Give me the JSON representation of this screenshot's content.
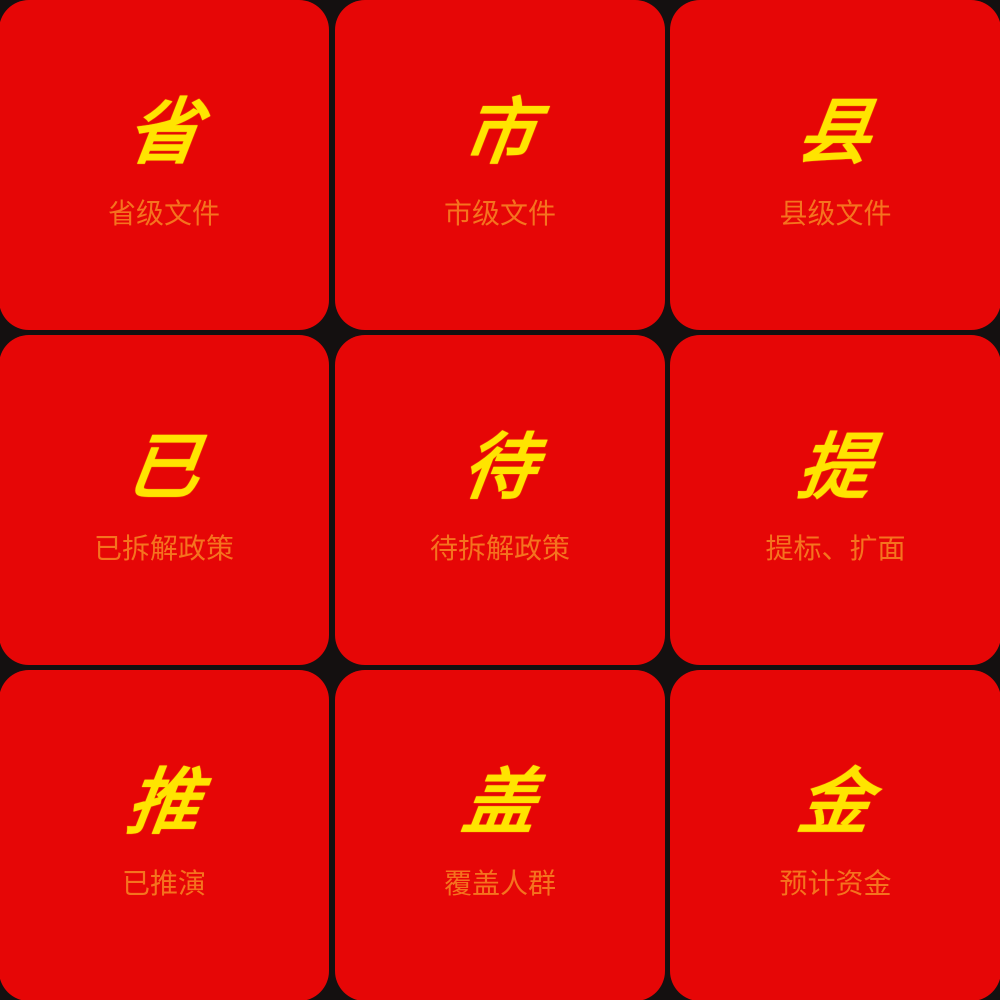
{
  "tiles": [
    {
      "id": "province",
      "big": "省",
      "label": "省级文件"
    },
    {
      "id": "city",
      "big": "市",
      "label": "市级文件"
    },
    {
      "id": "county",
      "big": "县",
      "label": "县级文件"
    },
    {
      "id": "decomposed",
      "big": "已",
      "label": "已拆解政策"
    },
    {
      "id": "pending",
      "big": "待",
      "label": "待拆解政策"
    },
    {
      "id": "raise",
      "big": "提",
      "label": "提标、扩面"
    },
    {
      "id": "deduced",
      "big": "推",
      "label": "已推演"
    },
    {
      "id": "coverage",
      "big": "盖",
      "label": "覆盖人群"
    },
    {
      "id": "funds",
      "big": "金",
      "label": "预计资金"
    }
  ],
  "colors": {
    "tile_bg": "#e60606",
    "big_text": "#ffe400",
    "label_text": "#f5731e",
    "gutter": "#141010"
  }
}
